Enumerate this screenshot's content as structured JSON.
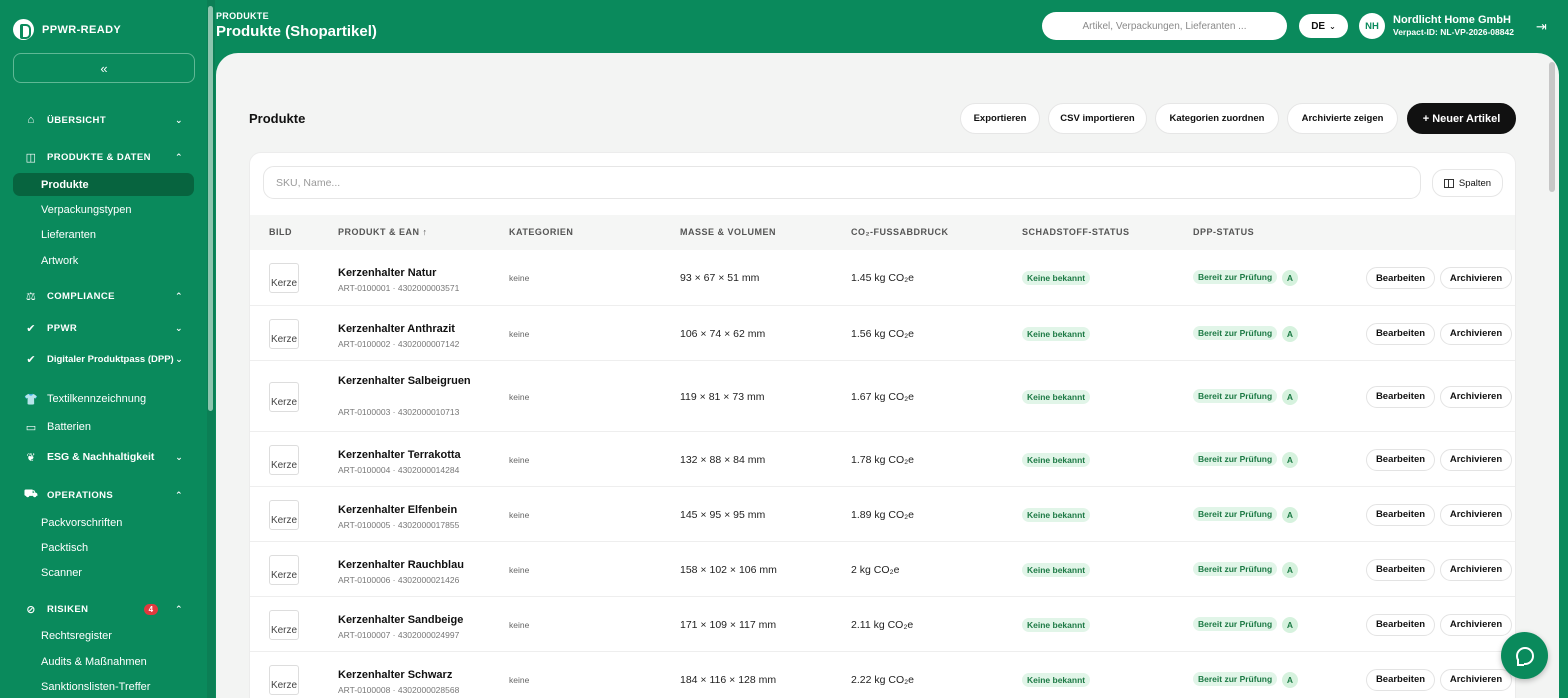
{
  "brand": {
    "name": "PPWR-READY",
    "collapse_label": "«"
  },
  "sidebar": {
    "groups": [
      {
        "label": "ÜBERSICHT",
        "icon": "home-icon",
        "chev": "⌄"
      },
      {
        "label": "PRODUKTE & DATEN",
        "icon": "box-icon",
        "chev": "⌃"
      },
      {
        "label": "COMPLIANCE",
        "icon": "scale-icon",
        "chev": "⌃"
      },
      {
        "label": "PPWR",
        "icon": "check-circle-icon",
        "chev": "⌄"
      },
      {
        "label": "Digitaler Produktpass (DPP)",
        "icon": "check-circle-icon",
        "chev": "⌄"
      },
      {
        "label": "Textilkennzeichnung",
        "icon": "shirt-icon",
        "chev": ""
      },
      {
        "label": "Batterien",
        "icon": "battery-icon",
        "chev": ""
      },
      {
        "label": "ESG & Nachhaltigkeit",
        "icon": "leaf-icon",
        "chev": "⌄"
      },
      {
        "label": "OPERATIONS",
        "icon": "truck-icon",
        "chev": "⌃"
      },
      {
        "label": "RISIKEN",
        "icon": "alert-icon",
        "chev": "⌃",
        "badge": "4"
      }
    ],
    "items": {
      "produkte": "Produkte",
      "verpackungstypen": "Verpackungstypen",
      "lieferanten": "Lieferanten",
      "artwork": "Artwork",
      "packvorschriften": "Packvorschriften",
      "packtisch": "Packtisch",
      "scanner": "Scanner",
      "rechtsregister": "Rechtsregister",
      "audits": "Audits & Maßnahmen",
      "sanktionslisten": "Sanktionslisten-Treffer"
    }
  },
  "header": {
    "breadcrumb": "PRODUKTE",
    "title": "Produkte (Shopartikel)",
    "search_placeholder": "Artikel, Verpackungen, Lieferanten ...",
    "language": "DE",
    "avatar_initials": "NH",
    "company_name": "Nordlicht Home GmbH",
    "company_id": "Verpact-ID: NL-VP-2026-08842"
  },
  "toolbar": {
    "section_title": "Produkte",
    "export": "Exportieren",
    "csv_import": "CSV importieren",
    "assign_categories": "Kategorien zuordnen",
    "show_archived": "Archivierte zeigen",
    "new_item": "+ Neuer Artikel"
  },
  "filter": {
    "placeholder": "SKU, Name...",
    "columns_label": "Spalten"
  },
  "table": {
    "headers": [
      "BILD",
      "PRODUKT & EAN ↑",
      "KATEGORIEN",
      "MASSE & VOLUMEN",
      "CO₂-FUSSABDRUCK",
      "SCHADSTOFF-STATUS",
      "DPP-STATUS"
    ],
    "rows": [
      {
        "img_alt": "Kerze",
        "name": "Kerzenhalter Natur",
        "sku": "ART-0100001 · 4302000003571",
        "category": "keine",
        "dims": "93 × 67 × 51 mm",
        "co2": "1.45 kg CO₂e",
        "hazard": "Keine bekannt",
        "dpp": "Bereit zur Prüfung",
        "grade": "A",
        "edit": "Bearbeiten",
        "archive": "Archivieren"
      },
      {
        "img_alt": "Kerze",
        "name": "Kerzenhalter Anthrazit",
        "sku": "ART-0100002 · 4302000007142",
        "category": "keine",
        "dims": "106 × 74 × 62 mm",
        "co2": "1.56 kg CO₂e",
        "hazard": "Keine bekannt",
        "dpp": "Bereit zur Prüfung",
        "grade": "A",
        "edit": "Bearbeiten",
        "archive": "Archivieren"
      },
      {
        "img_alt": "Kerze",
        "name": "Kerzenhalter Salbeigruen",
        "sku": "ART-0100003 · 4302000010713",
        "category": "keine",
        "dims": "119 × 81 × 73 mm",
        "co2": "1.67 kg CO₂e",
        "hazard": "Keine bekannt",
        "dpp": "Bereit zur Prüfung",
        "grade": "A",
        "edit": "Bearbeiten",
        "archive": "Archivieren"
      },
      {
        "img_alt": "Kerze",
        "name": "Kerzenhalter Terrakotta",
        "sku": "ART-0100004 · 4302000014284",
        "category": "keine",
        "dims": "132 × 88 × 84 mm",
        "co2": "1.78 kg CO₂e",
        "hazard": "Keine bekannt",
        "dpp": "Bereit zur Prüfung",
        "grade": "A",
        "edit": "Bearbeiten",
        "archive": "Archivieren"
      },
      {
        "img_alt": "Kerze",
        "name": "Kerzenhalter Elfenbein",
        "sku": "ART-0100005 · 4302000017855",
        "category": "keine",
        "dims": "145 × 95 × 95 mm",
        "co2": "1.89 kg CO₂e",
        "hazard": "Keine bekannt",
        "dpp": "Bereit zur Prüfung",
        "grade": "A",
        "edit": "Bearbeiten",
        "archive": "Archivieren"
      },
      {
        "img_alt": "Kerze",
        "name": "Kerzenhalter Rauchblau",
        "sku": "ART-0100006 · 4302000021426",
        "category": "keine",
        "dims": "158 × 102 × 106 mm",
        "co2": "2 kg CO₂e",
        "hazard": "Keine bekannt",
        "dpp": "Bereit zur Prüfung",
        "grade": "A",
        "edit": "Bearbeiten",
        "archive": "Archivieren"
      },
      {
        "img_alt": "Kerze",
        "name": "Kerzenhalter Sandbeige",
        "sku": "ART-0100007 · 4302000024997",
        "category": "keine",
        "dims": "171 × 109 × 117 mm",
        "co2": "2.11 kg CO₂e",
        "hazard": "Keine bekannt",
        "dpp": "Bereit zur Prüfung",
        "grade": "A",
        "edit": "Bearbeiten",
        "archive": "Archivieren"
      },
      {
        "img_alt": "Kerze",
        "name": "Kerzenhalter Schwarz",
        "sku": "ART-0100008 · 4302000028568",
        "category": "keine",
        "dims": "184 × 116 × 128 mm",
        "co2": "2.22 kg CO₂e",
        "hazard": "Keine bekannt",
        "dpp": "Bereit zur Prüfung",
        "grade": "A",
        "edit": "Bearbeiten",
        "archive": "Archivieren"
      }
    ]
  },
  "colors": {
    "brand_green": "#0a8a5c",
    "active_nav": "#07643f",
    "status_bg": "#e1f5e8",
    "status_text": "#1d7a45"
  }
}
